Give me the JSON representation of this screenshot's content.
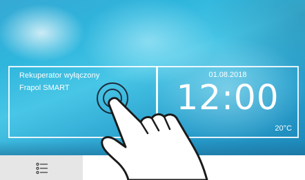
{
  "tiles": {
    "ventilation": {
      "status": "Rekuperator wyłączony",
      "device": "Frapol SMART"
    },
    "clock": {
      "date": "01.08.2018",
      "time": "12:00",
      "temperature": "20°C"
    }
  },
  "bottom_bar": {
    "menu_icon": "menu-list-icon"
  },
  "overlay": {
    "icon": "pointing-hand-icon"
  },
  "colors": {
    "screen_top": "#35a9d4",
    "screen_bottom": "#1b86b8",
    "tile_text": "#ffffff",
    "menu_tab": "#e6e6e6"
  }
}
